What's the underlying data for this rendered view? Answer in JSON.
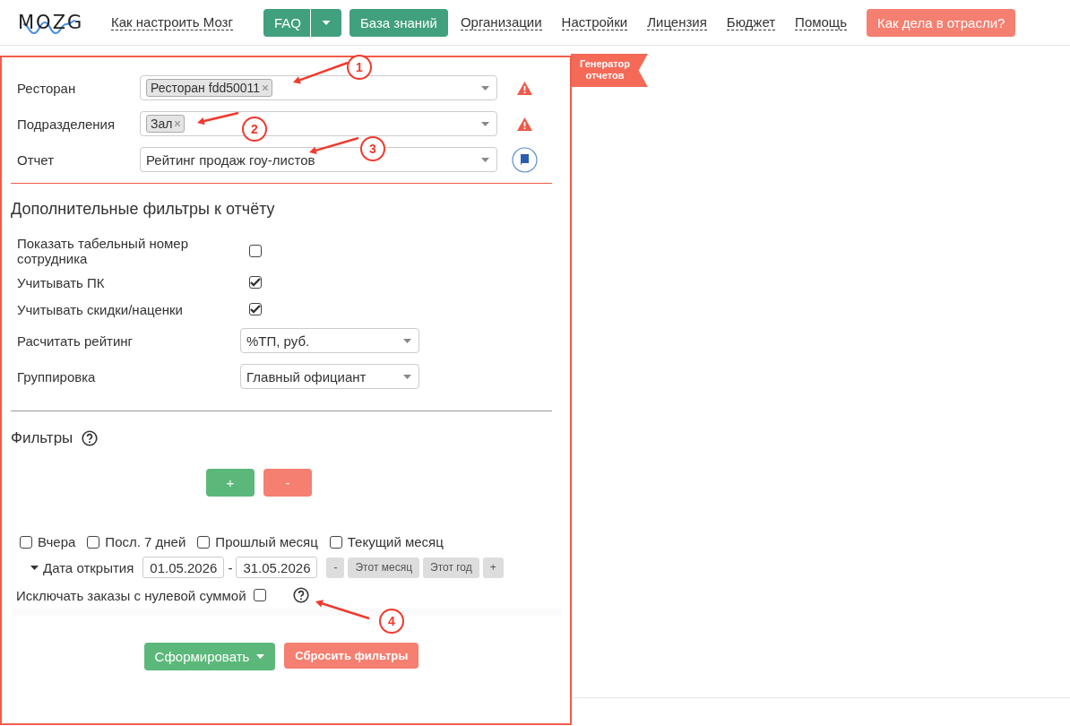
{
  "header": {
    "logo": "MOZG",
    "nav": [
      {
        "kind": "link",
        "label": "Как настроить Мозг"
      },
      {
        "kind": "split",
        "label": "FAQ"
      },
      {
        "kind": "primary",
        "label": "База знаний"
      },
      {
        "kind": "link",
        "label": "Организации"
      },
      {
        "kind": "link",
        "label": "Настройки"
      },
      {
        "kind": "link",
        "label": "Лицензия"
      },
      {
        "kind": "link",
        "label": "Бюджет"
      },
      {
        "kind": "link",
        "label": "Помощь"
      },
      {
        "kind": "accent",
        "label": "Как дела в отрасли?"
      }
    ]
  },
  "ribbon": {
    "line1": "Генератор",
    "line2": "отчетов"
  },
  "main_fields": [
    {
      "label": "Ресторан",
      "kind": "tags",
      "tags": [
        "Ресторан fdd50011"
      ],
      "invalid": true
    },
    {
      "label": "Подразделения",
      "kind": "tags",
      "tags": [
        "Зал"
      ],
      "invalid": true
    },
    {
      "label": "Отчет",
      "kind": "value",
      "value": "Рейтинг продаж гоу-листов",
      "invalid": false
    }
  ],
  "extra_filters": {
    "title": "Дополнительные фильтры к отчёту",
    "rows": [
      {
        "kind": "checkbox",
        "label": "Показать табельный номер сотрудника",
        "checked": false
      },
      {
        "kind": "checkbox",
        "label": "Учитывать ПК",
        "checked": true
      },
      {
        "kind": "checkbox",
        "label": "Учитывать скидки/наценки",
        "checked": true
      },
      {
        "kind": "select",
        "label": "Расчитать рейтинг",
        "value": "%ТП, руб."
      },
      {
        "kind": "select",
        "label": "Группировка",
        "value": "Главный официант"
      }
    ]
  },
  "filters": {
    "title": "Фильтры",
    "add": "+",
    "remove": "-"
  },
  "periods": [
    {
      "label": "Вчера",
      "checked": false
    },
    {
      "label": "Посл. 7 дней",
      "checked": false
    },
    {
      "label": "Прошлый месяц",
      "checked": false
    },
    {
      "label": "Текущий месяц",
      "checked": false
    }
  ],
  "date": {
    "label": "Дата открытия",
    "from": "01.05.2026",
    "separator": "-",
    "to": "31.05.2026",
    "buttons": [
      "-",
      "Этот месяц",
      "Этот год",
      "+"
    ]
  },
  "exclude_zero": {
    "label": "Исключать заказы с нулевой суммой",
    "checked": false
  },
  "actions": {
    "submit": "Сформировать",
    "reset": "Сбросить фильтры"
  },
  "annotations": [
    "1",
    "2",
    "3",
    "4"
  ]
}
